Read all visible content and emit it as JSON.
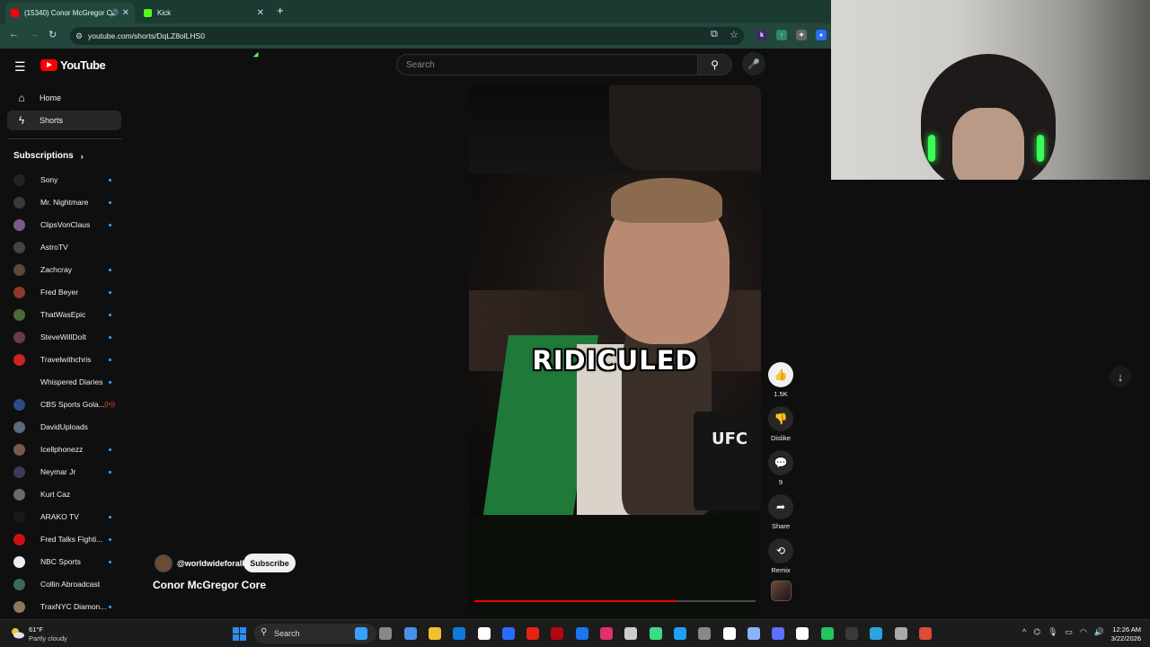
{
  "browser": {
    "tabs": [
      {
        "title": "(15340) Conor McGregor C",
        "active": true,
        "favicon_color": "#ff0000"
      },
      {
        "title": "Kick",
        "active": false,
        "favicon_color": "#53fc18"
      }
    ],
    "url": "youtube.com/shorts/DqLZ8olLHS0"
  },
  "youtube": {
    "logo_text": "YouTube",
    "search_placeholder": "Search",
    "nav": [
      {
        "label": "Home",
        "icon": "home-icon",
        "active": false
      },
      {
        "label": "Shorts",
        "icon": "shorts-icon",
        "active": true
      }
    ],
    "subscriptions_label": "Subscriptions",
    "subscriptions": [
      {
        "name": "Sony",
        "color": "#222222",
        "dot": true
      },
      {
        "name": "Mr. Nightmare",
        "color": "#3a3a3a",
        "dot": true
      },
      {
        "name": "ClipsVonClaus",
        "color": "#7a5a8a",
        "dot": true
      },
      {
        "name": "AstroTV",
        "color": "#444444",
        "dot": false
      },
      {
        "name": "Zachcray",
        "color": "#5a4a3a",
        "dot": true
      },
      {
        "name": "Fred Beyer",
        "color": "#8a3a2a",
        "dot": true
      },
      {
        "name": "ThatWasEpic",
        "color": "#4a6a3a",
        "dot": true
      },
      {
        "name": "SteveWillDoIt",
        "color": "#6a3a4a",
        "dot": true
      },
      {
        "name": "Travelwithchris",
        "color": "#cc2222",
        "dot": true
      },
      {
        "name": "Whispered Diaries",
        "color": "#111111",
        "dot": true
      },
      {
        "name": "CBS Sports Gola...",
        "color": "#2a4a8a",
        "live": true
      },
      {
        "name": "DavidUploads",
        "color": "#5a6a7a",
        "dot": false
      },
      {
        "name": "Icellphonezz",
        "color": "#7a5a4a",
        "dot": true
      },
      {
        "name": "Neymar Jr",
        "color": "#3a3a5a",
        "dot": true
      },
      {
        "name": "Kurt Caz",
        "color": "#6a6a6a",
        "dot": false
      },
      {
        "name": "ARAKO TV",
        "color": "#1a1a1a",
        "dot": true
      },
      {
        "name": "Fred Talks Fighti...",
        "color": "#cc1111",
        "dot": true
      },
      {
        "name": "NBC Sports",
        "color": "#eeeeee",
        "dot": true
      },
      {
        "name": "Collin Abroadcast",
        "color": "#3a6a5a",
        "dot": false
      },
      {
        "name": "TraxNYC Diamon...",
        "color": "#8a7a5a",
        "dot": true
      }
    ],
    "short": {
      "caption": "RIDICULED",
      "channel_handle": "@worldwideforall",
      "subscribe_label": "Subscribe",
      "title": "Conor McGregor Core",
      "progress": 0.72,
      "mic_label": "UFC"
    },
    "actions": [
      {
        "icon": "thumbs-up-icon",
        "glyph": "👍",
        "label": "1.5K",
        "highlight": true
      },
      {
        "icon": "thumbs-down-icon",
        "glyph": "👎",
        "label": "Dislike",
        "highlight": false
      },
      {
        "icon": "comment-icon",
        "glyph": "💬",
        "label": "9",
        "highlight": false
      },
      {
        "icon": "share-icon",
        "glyph": "➦",
        "label": "Share",
        "highlight": false
      },
      {
        "icon": "remix-icon",
        "glyph": "⟲",
        "label": "Remix",
        "highlight": false
      }
    ]
  },
  "taskbar": {
    "weather_temp": "61°F",
    "weather_desc": "Partly cloudy",
    "search_label": "Search",
    "time": "12:26 AM",
    "date": "3/22/2026",
    "apps": [
      "#3aa0ff",
      "#888888",
      "#4a90e2",
      "#f2c12e",
      "#0f7bd9",
      "#ffffff",
      "#2a6cff",
      "#e62117",
      "#b20710",
      "#1877f2",
      "#e1306c",
      "#cccccc",
      "#3ddc84",
      "#1da1f2",
      "#888888",
      "#ffffff",
      "#8ab4f8",
      "#5f6fff",
      "#ffffff",
      "#22c55e",
      "#3a3a3a",
      "#2aa3df",
      "#aaaaaa",
      "#dd4b39"
    ]
  }
}
